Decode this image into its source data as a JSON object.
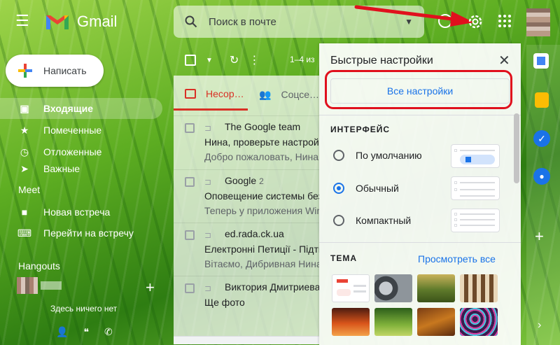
{
  "app": {
    "logo_text": "Gmail"
  },
  "search": {
    "placeholder": "Поиск в почте"
  },
  "compose": {
    "label": "Написать"
  },
  "nav": [
    {
      "label": "Входящие",
      "icon": "inbox-icon",
      "active": true
    },
    {
      "label": "Помеченные",
      "icon": "star-icon"
    },
    {
      "label": "Отложенные",
      "icon": "clock-icon"
    },
    {
      "label": "Важные",
      "icon": "label-important-icon"
    }
  ],
  "meet": {
    "title": "Meet",
    "items": [
      {
        "label": "Новая встреча",
        "icon": "video-icon"
      },
      {
        "label": "Перейти на встречу",
        "icon": "keyboard-icon"
      }
    ]
  },
  "hangouts": {
    "title": "Hangouts",
    "empty": "Здесь ничего нет"
  },
  "list": {
    "range": "1–4 из",
    "tabs": [
      {
        "label": "Несор…",
        "icon": "inbox-icon"
      },
      {
        "label": "Соцсе…",
        "icon": "people-icon"
      }
    ],
    "emails": [
      {
        "sender": "The Google team",
        "count": "",
        "subject": "Нина, проверьте настройки",
        "snippet": "Добро пожаловать, Нина"
      },
      {
        "sender": "Google",
        "count": "2",
        "subject": "Оповещение системы безопасности",
        "snippet": "Теперь у приложения Windows"
      },
      {
        "sender": "ed.rada.ck.ua",
        "count": "",
        "subject": "Електронні Петиції - Підтвердження",
        "snippet": "Вітаємо, Дибривная Нина"
      },
      {
        "sender": "Виктория Дмитриева",
        "count": "",
        "subject": "Ще фото",
        "snippet": ""
      }
    ]
  },
  "quick_settings": {
    "title": "Быстрые настройки",
    "all_settings": "Все настройки",
    "density_section": "ИНТЕРФЕЙС",
    "density_options": [
      {
        "label": "По умолчанию",
        "checked": false
      },
      {
        "label": "Обычный",
        "checked": true
      },
      {
        "label": "Компактный",
        "checked": false
      }
    ],
    "theme_section": "ТЕМА",
    "view_all": "Просмотреть все"
  },
  "colors": {
    "accent": "#1a73e8",
    "highlight": "#e0101d",
    "inbox_red": "#d93025"
  }
}
